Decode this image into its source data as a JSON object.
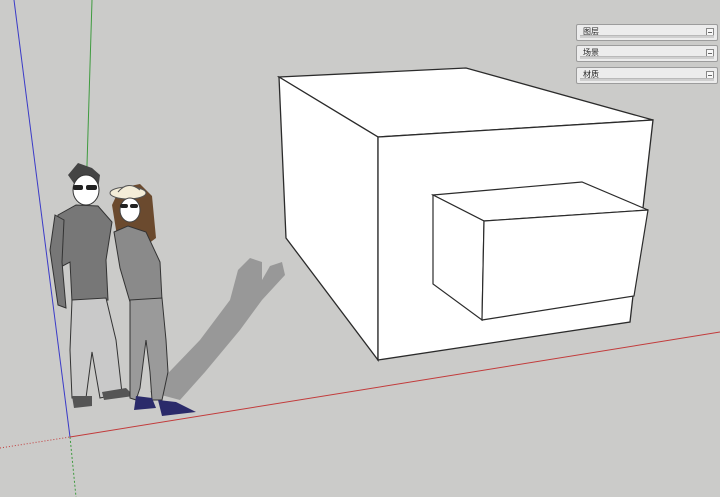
{
  "trays": [
    {
      "title": "图层"
    },
    {
      "title": "场景"
    },
    {
      "title": "材质"
    }
  ],
  "colors": {
    "background": "#cbcbc9",
    "axis_red": "#c23b3b",
    "axis_green": "#3f9b3f",
    "axis_blue": "#3b3bc8",
    "face_white": "#ffffff",
    "edge": "#2b2b2b",
    "shadow": "#8a8a8a"
  },
  "objects": [
    "box-model",
    "protruding-box",
    "person-man",
    "person-woman"
  ]
}
